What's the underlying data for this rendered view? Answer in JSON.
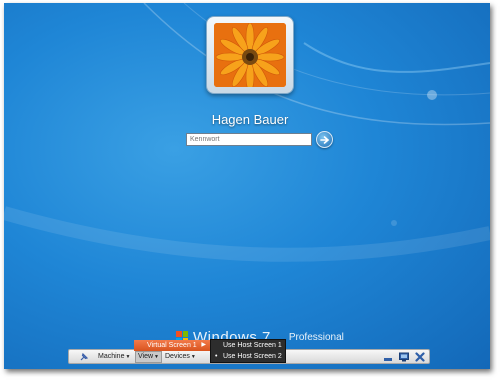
{
  "login": {
    "username": "Hagen Bauer",
    "password_placeholder": "Kennwort",
    "submit_icon": "arrow-right-icon"
  },
  "branding": {
    "product": "Windows 7",
    "edition": "Professional"
  },
  "toolbar": {
    "pin_icon": "pin-icon",
    "machine_label": "Machine",
    "view_label": "View",
    "devices_label": "Devices",
    "minimize_icon": "minimize-icon",
    "screen_icon": "monitor-icon",
    "close_icon": "close-icon"
  },
  "view_menu": {
    "virtual_screen_label": "Virtual Screen 1",
    "items": [
      {
        "label": "Use Host Screen 1",
        "selected": false
      },
      {
        "label": "Use Host Screen 2",
        "selected": true
      }
    ]
  },
  "colors": {
    "desktop_blue": "#1f86d6",
    "menu_highlight": "#e8643a",
    "menu_background": "#2d2d2d"
  }
}
